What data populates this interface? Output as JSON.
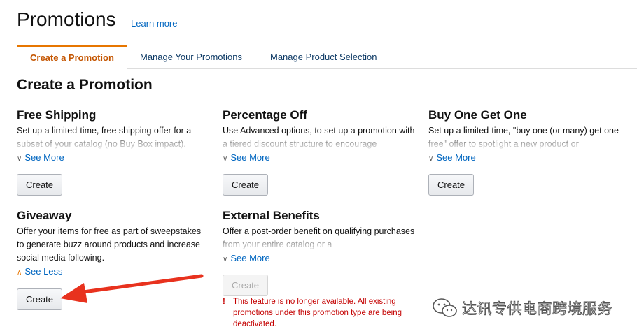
{
  "header": {
    "title": "Promotions",
    "learn_more": "Learn more"
  },
  "tabs": [
    {
      "label": "Create a Promotion",
      "active": true
    },
    {
      "label": "Manage Your Promotions",
      "active": false
    },
    {
      "label": "Manage Product Selection",
      "active": false
    }
  ],
  "section_title": "Create a Promotion",
  "cards": [
    {
      "title": "Free Shipping",
      "description": "Set up a limited-time, free shipping offer for a subset of your catalog (no Buy Box impact).",
      "toggle": "See More",
      "button": "Create"
    },
    {
      "title": "Percentage Off",
      "description": "Use Advanced options, to set up a promotion with a tiered discount structure to encourage",
      "toggle": "See More",
      "button": "Create"
    },
    {
      "title": "Buy One Get One",
      "description": "Set up a limited-time, \"buy one (or many) get one free\" offer to spotlight a new product or",
      "toggle": "See More",
      "button": "Create"
    },
    {
      "title": "Giveaway",
      "description": "Offer your items for free as part of sweepstakes to generate buzz around products and increase social media following.",
      "toggle": "See Less",
      "button": "Create"
    },
    {
      "title": "External Benefits",
      "description": "Offer a post-order benefit on qualifying purchases from your entire catalog or a",
      "toggle": "See More",
      "button": "Create",
      "button_disabled": true,
      "warning": "This feature is no longer available. All existing promotions under this promotion type are being deactivated."
    }
  ],
  "annotation": {
    "arrow_color": "#e8321e"
  },
  "watermark": {
    "text": "达讯专供电商跨境服务"
  },
  "colors": {
    "link": "#0066c0",
    "active_tab": "#c45500",
    "tab_accent": "#e77600",
    "warning": "#c40000"
  }
}
